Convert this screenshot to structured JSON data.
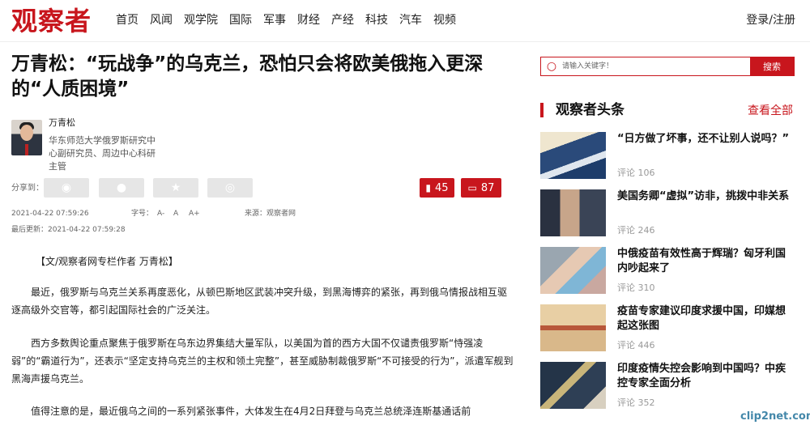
{
  "header": {
    "logo": "观察者",
    "nav": [
      "首页",
      "风闻",
      "观学院",
      "国际",
      "军事",
      "财经",
      "产经",
      "科技",
      "汽车",
      "视频"
    ],
    "login": "登录/注册"
  },
  "article": {
    "title": "万青松：“玩战争”的乌克兰，恐怕只会将欧美俄拖入更深的“人质困境”",
    "author_name": "万青松",
    "author_bio": "华东师范大学俄罗斯研究中心副研究员、周边中心科研主管",
    "share_label": "分享到：",
    "bookmark_count": "45",
    "comment_count": "87",
    "published": "2021-04-22 07:59:26",
    "font_size_label": "字号：",
    "font_size_options": [
      "A-",
      "A",
      "A+"
    ],
    "source": "来源：观察者网",
    "updated": "最后更新：2021-04-22 07:59:28",
    "byline": "【文/观察者网专栏作者 万青松】",
    "paragraphs": [
      "最近，俄罗斯与乌克兰关系再度恶化，从顿巴斯地区武装冲突升级，到黑海博弈的紧张，再到俄乌情报战相互驱逐高级外交官等，都引起国际社会的广泛关注。",
      "西方多数舆论重点聚焦于俄罗斯在乌东边界集结大量军队，以美国为首的西方大国不仅谴责俄罗斯“恃强凌弱”的“霸道行为”，还表示“坚定支持乌克兰的主权和领土完整”，甚至威胁制裁俄罗斯“不可接受的行为”，派遣军舰到黑海声援乌克兰。",
      "值得注意的是，最近俄乌之间的一系列紧张事件，大体发生在4月2日拜登与乌克兰总统泽连斯基通话前"
    ]
  },
  "sidebar": {
    "search_placeholder": "请输入关键字！",
    "search_button": "搜索",
    "section_title": "观察者头条",
    "view_all": "查看全部",
    "items": [
      {
        "title": "“日方做了坏事，还不让别人说吗？”",
        "comments": "评论 106"
      },
      {
        "title": "美国务卿“虚拟”访非，挑拨中非关系",
        "comments": "评论 246"
      },
      {
        "title": "中俄疫苗有效性高于辉瑞？匈牙利国内吵起来了",
        "comments": "评论 310"
      },
      {
        "title": "疫苗专家建议印度求援中国，印媒想起这张图",
        "comments": "评论 446"
      },
      {
        "title": "印度疫情失控会影响到中国吗？中疾控专家全面分析",
        "comments": "评论 352"
      }
    ]
  },
  "watermark": "clip2net.com"
}
